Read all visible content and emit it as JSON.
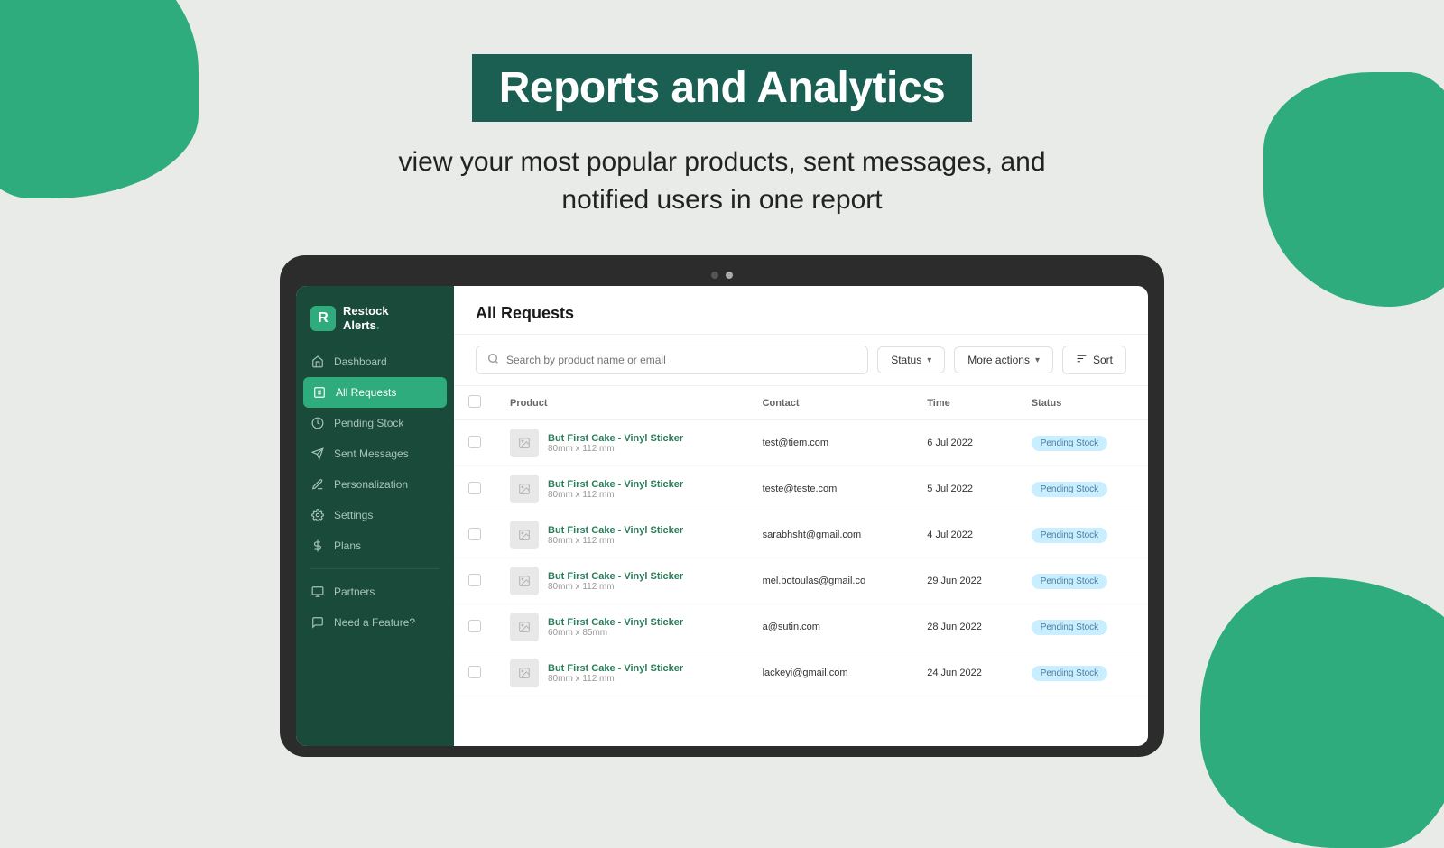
{
  "page": {
    "title": "Reports and Analytics",
    "subtitle_line1": "view your most popular products, sent messages, and",
    "subtitle_line2": "notified users in one report"
  },
  "sidebar": {
    "logo": {
      "icon": "R",
      "line1": "Restock",
      "line2": "Alerts",
      "dot": "."
    },
    "nav_items": [
      {
        "id": "dashboard",
        "label": "Dashboard",
        "active": false
      },
      {
        "id": "all-requests",
        "label": "All Requests",
        "active": true
      },
      {
        "id": "pending-stock",
        "label": "Pending Stock",
        "active": false
      },
      {
        "id": "sent-messages",
        "label": "Sent Messages",
        "active": false
      },
      {
        "id": "personalization",
        "label": "Personalization",
        "active": false
      },
      {
        "id": "settings",
        "label": "Settings",
        "active": false
      },
      {
        "id": "plans",
        "label": "Plans",
        "active": false
      }
    ],
    "bottom_items": [
      {
        "id": "partners",
        "label": "Partners"
      },
      {
        "id": "need-feature",
        "label": "Need a Feature?"
      }
    ]
  },
  "main": {
    "title": "All Requests",
    "toolbar": {
      "search_placeholder": "Search by product name or email",
      "status_label": "Status",
      "more_actions_label": "More actions",
      "sort_label": "Sort"
    },
    "table": {
      "columns": [
        "",
        "Product",
        "Contact",
        "Time",
        "Status"
      ],
      "rows": [
        {
          "product_name": "But First Cake - Vinyl Sticker",
          "product_variant": "80mm x 112 mm",
          "contact": "test@tiem.com",
          "time": "6 Jul 2022",
          "status": "Pending Stock"
        },
        {
          "product_name": "But First Cake - Vinyl Sticker",
          "product_variant": "80mm x 112 mm",
          "contact": "teste@teste.com",
          "time": "5 Jul 2022",
          "status": "Pending Stock"
        },
        {
          "product_name": "But First Cake - Vinyl Sticker",
          "product_variant": "80mm x 112 mm",
          "contact": "sarabhsht@gmail.com",
          "time": "4 Jul 2022",
          "status": "Pending Stock"
        },
        {
          "product_name": "But First Cake - Vinyl Sticker",
          "product_variant": "80mm x 112 mm",
          "contact": "mel.botoulas@gmail.co",
          "time": "29 Jun 2022",
          "status": "Pending Stock"
        },
        {
          "product_name": "But First Cake - Vinyl Sticker",
          "product_variant": "60mm x 85mm",
          "contact": "a@sutin.com",
          "time": "28 Jun 2022",
          "status": "Pending Stock"
        },
        {
          "product_name": "But First Cake - Vinyl Sticker",
          "product_variant": "80mm x 112 mm",
          "contact": "lackeyi@gmail.com",
          "time": "24 Jun 2022",
          "status": "Pending Stock"
        }
      ]
    }
  },
  "colors": {
    "accent": "#2eac7d",
    "sidebar_bg": "#1a4a3a",
    "title_bg": "#1a5f52",
    "pending_bg": "#c8eeff",
    "pending_text": "#4a7a9b"
  }
}
